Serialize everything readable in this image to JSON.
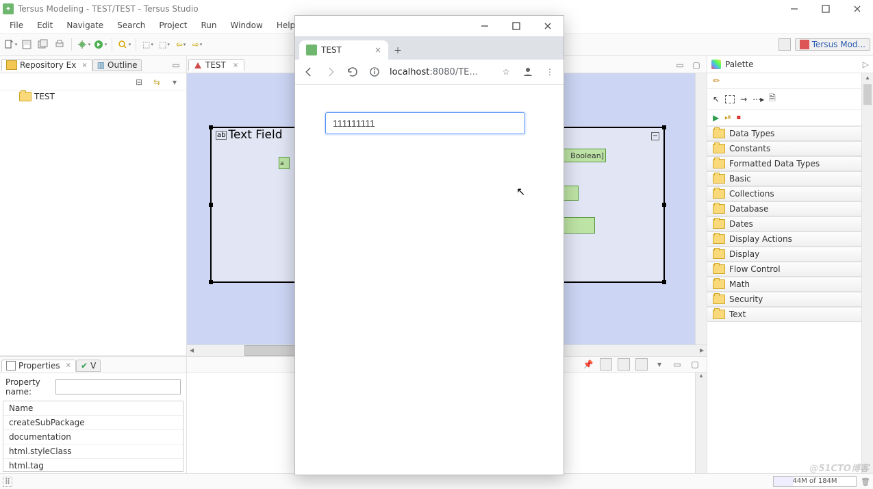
{
  "titlebar": {
    "title": "Tersus Modeling - TEST/TEST - Tersus Studio"
  },
  "menubar": {
    "items": [
      "File",
      "Edit",
      "Navigate",
      "Search",
      "Project",
      "Run",
      "Window",
      "Help"
    ]
  },
  "toolbar": {
    "perspective_tab": "Tersus Mod..."
  },
  "left_panel": {
    "repo_view_label": "Repository Ex",
    "outline_view_label": "Outline",
    "tree": {
      "root_label": "TEST"
    }
  },
  "editor": {
    "tabs": [
      {
        "label": "TEST"
      }
    ],
    "model": {
      "title": "Text Field",
      "partial_text_left": "a",
      "partial_text_right": "Boolean]"
    }
  },
  "properties": {
    "tab_label_properties": "Properties",
    "tab_label_validators": "V",
    "field_label": "Property name:",
    "header_name": "Name",
    "rows": [
      "createSubPackage",
      "documentation",
      "html.styleClass",
      "html.tag"
    ]
  },
  "palette": {
    "title": "Palette",
    "sections": [
      "Data Types",
      "Constants",
      "Formatted Data Types",
      "Basic",
      "Collections",
      "Database",
      "Dates",
      "Display Actions",
      "Display",
      "Flow Control",
      "Math",
      "Security",
      "Text"
    ]
  },
  "status": {
    "memory_text": "44M of 184M"
  },
  "browser": {
    "tab_title": "TEST",
    "url_host": "localhost",
    "url_port_path": ":8080/TE…",
    "page_input_value": "111111111"
  },
  "watermark_text": "@51CTO博客"
}
